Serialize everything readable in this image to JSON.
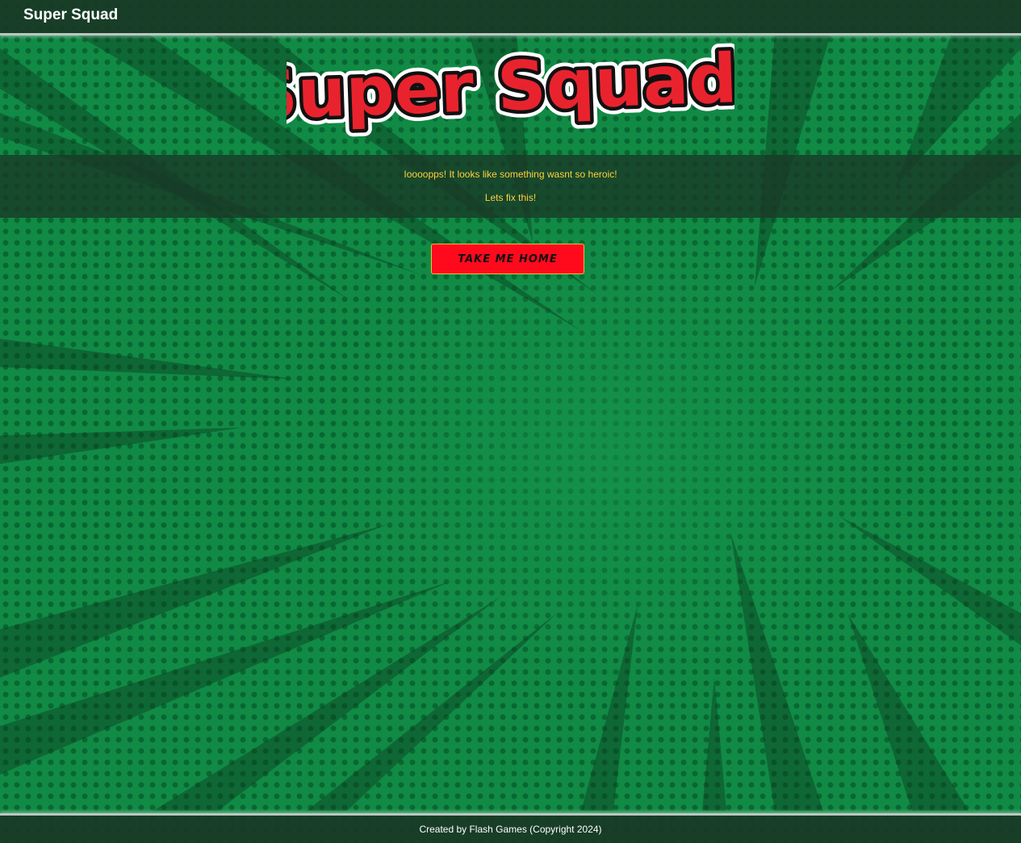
{
  "navbar": {
    "brand": "Super Squad"
  },
  "logo": {
    "text": "Super Squad!"
  },
  "banner": {
    "message_1": "Ioooopps! It looks like something wasnt so heroic!",
    "message_2": "Lets fix this!"
  },
  "actions": {
    "home_button_label": "Take me home"
  },
  "footer": {
    "text": "Created by Flash Games (Copyright 2024)"
  },
  "colors": {
    "background_green": "#118a45",
    "bar_dark": "#19372a",
    "message_yellow": "#ffd33a",
    "button_red": "#ff0a1c",
    "logo_red": "#e8232e"
  }
}
